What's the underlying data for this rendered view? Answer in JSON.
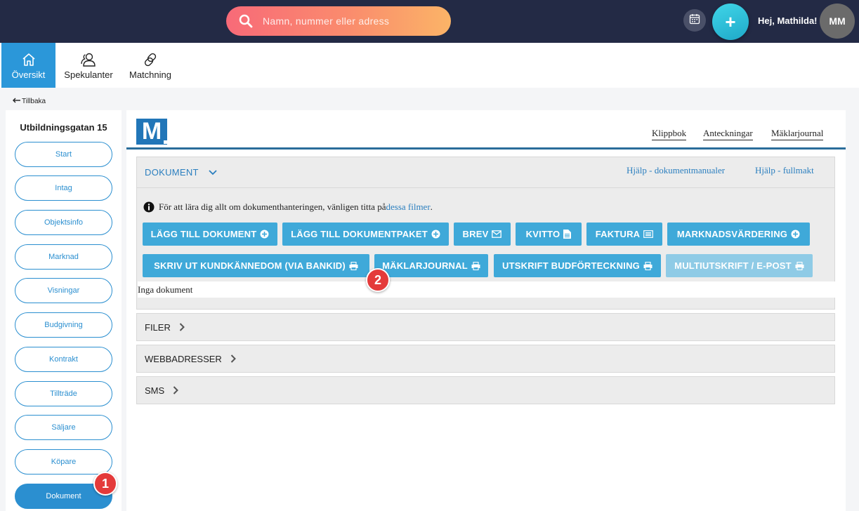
{
  "topbar": {
    "search_placeholder": "Namn, nummer eller adress",
    "plus_label": "+",
    "greeting": "Hej, Mathilda!",
    "avatar_initials": "MM"
  },
  "nav": {
    "items": [
      {
        "label": "Översikt",
        "icon": "home-icon",
        "active": true
      },
      {
        "label": "Spekulanter",
        "icon": "users-icon",
        "active": false
      },
      {
        "label": "Matchning",
        "icon": "link-icon",
        "active": false
      }
    ]
  },
  "back_label": "Tillbaka",
  "sidebar": {
    "title": "Utbildningsgatan 15",
    "items": [
      {
        "label": "Start"
      },
      {
        "label": "Intag"
      },
      {
        "label": "Objektsinfo"
      },
      {
        "label": "Marknad"
      },
      {
        "label": "Visningar"
      },
      {
        "label": "Budgivning"
      },
      {
        "label": "Kontrakt"
      },
      {
        "label": "Tillträde"
      },
      {
        "label": "Säljare"
      },
      {
        "label": "Köpare"
      },
      {
        "label": "Dokument",
        "active": true
      }
    ]
  },
  "badges": [
    "1",
    "2"
  ],
  "main": {
    "logo_letter": "M",
    "top_links": [
      "Klippbok",
      "Anteckningar",
      "Mäklarjournal"
    ],
    "documents": {
      "title": "DOKUMENT",
      "help_links": [
        "Hjälp - dokumentmanualer",
        "Hjälp - fullmakt"
      ],
      "info_text": "För att lära dig allt om dokumenthanteringen, vänligen titta på ",
      "info_link": "dessa filmer",
      "info_end": ".",
      "buttons_row1": [
        {
          "label": "LÄGG TILL DOKUMENT",
          "icon": "plus-circle-icon"
        },
        {
          "label": "LÄGG TILL DOKUMENTPAKET",
          "icon": "plus-circle-icon"
        },
        {
          "label": "BREV",
          "icon": "envelope-icon"
        },
        {
          "label": "KVITTO",
          "icon": "file-icon"
        },
        {
          "label": "FAKTURA",
          "icon": "list-icon"
        },
        {
          "label": "MARKNADSVÄRDERING",
          "icon": "plus-circle-icon"
        }
      ],
      "buttons_row2": [
        {
          "label": "SKRIV UT KUNDKÄNNEDOM (VIA BANKID)",
          "icon": "print-icon"
        },
        {
          "label": "MÄKLARJOURNAL",
          "icon": "print-icon"
        },
        {
          "label": "UTSKRIFT BUDFÖRTECKNING",
          "icon": "print-icon"
        },
        {
          "label": "MULTIUTSKRIFT / E-POST",
          "icon": "print-icon",
          "disabled": true
        }
      ],
      "empty_text": "Inga dokument"
    },
    "sections": [
      {
        "label": "FILER"
      },
      {
        "label": "WEBBADRESSER"
      },
      {
        "label": "SMS"
      }
    ]
  },
  "colors": {
    "topbar": "#232a45",
    "accent": "#2b97d9",
    "button": "#3fa9d9",
    "badge": "#e43a3a"
  }
}
